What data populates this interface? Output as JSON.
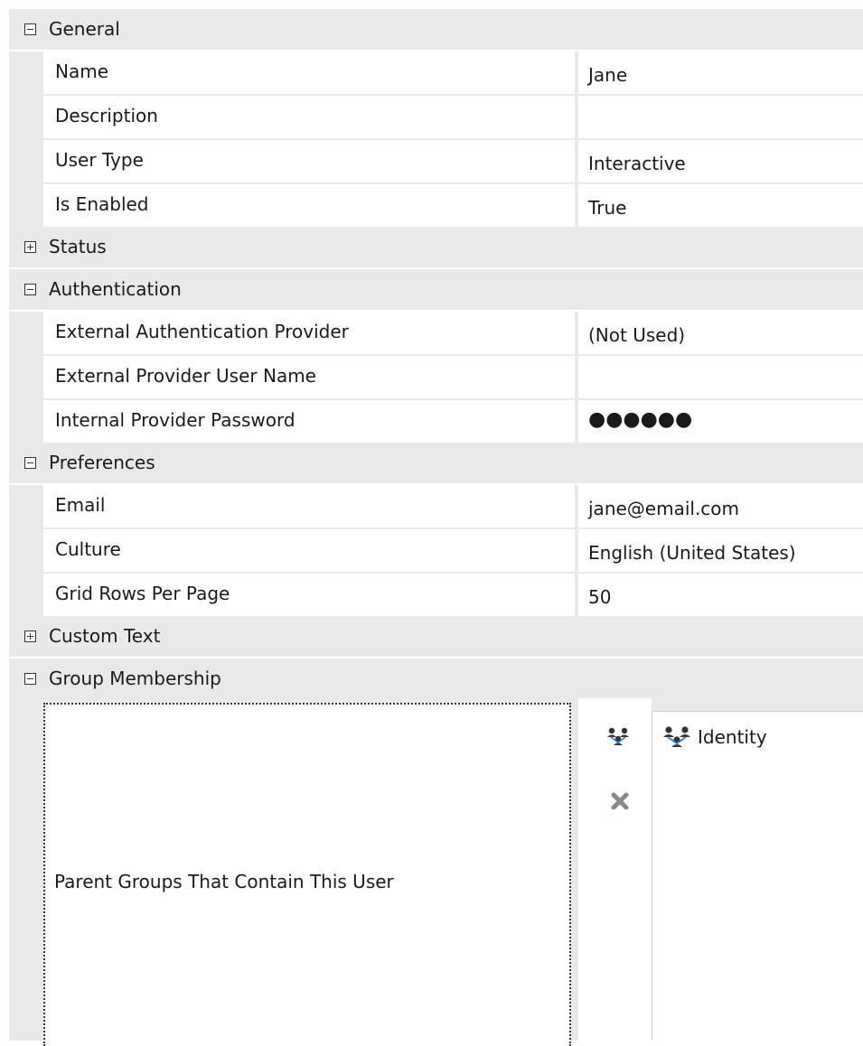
{
  "categories": {
    "general": {
      "label": "General",
      "expanded": true
    },
    "status": {
      "label": "Status",
      "expanded": false
    },
    "authentication": {
      "label": "Authentication",
      "expanded": true
    },
    "preferences": {
      "label": "Preferences",
      "expanded": true
    },
    "custom_text": {
      "label": "Custom Text",
      "expanded": false
    },
    "group_membership": {
      "label": "Group Membership",
      "expanded": true
    }
  },
  "general": {
    "name": {
      "label": "Name",
      "value": "Jane"
    },
    "description": {
      "label": "Description",
      "value": ""
    },
    "user_type": {
      "label": "User Type",
      "value": "Interactive"
    },
    "is_enabled": {
      "label": "Is Enabled",
      "value": "True"
    }
  },
  "authentication": {
    "external_provider": {
      "label": "External Authentication Provider",
      "value": "(Not Used)"
    },
    "external_user_name": {
      "label": "External Provider User Name",
      "value": ""
    },
    "internal_password": {
      "label": "Internal Provider Password",
      "value": "●●●●●●"
    }
  },
  "preferences": {
    "email": {
      "label": "Email",
      "value": "jane@email.com"
    },
    "culture": {
      "label": "Culture",
      "value": "English (United States)"
    },
    "grid_rows": {
      "label": "Grid Rows Per Page",
      "value": "50"
    }
  },
  "group_membership": {
    "left_label": "Parent Groups That Contain This User",
    "add_icon": "add-group-icon",
    "remove_icon": "remove-icon",
    "items": [
      {
        "label": "Identity",
        "icon": "group-icon"
      }
    ]
  },
  "colors": {
    "category_bg": "#e9e9e9",
    "cell_bg": "#ffffff",
    "text": "#1a1a1a",
    "remove_icon": "#8a8a8a",
    "group_icon_accent": "#2b7bd6"
  }
}
